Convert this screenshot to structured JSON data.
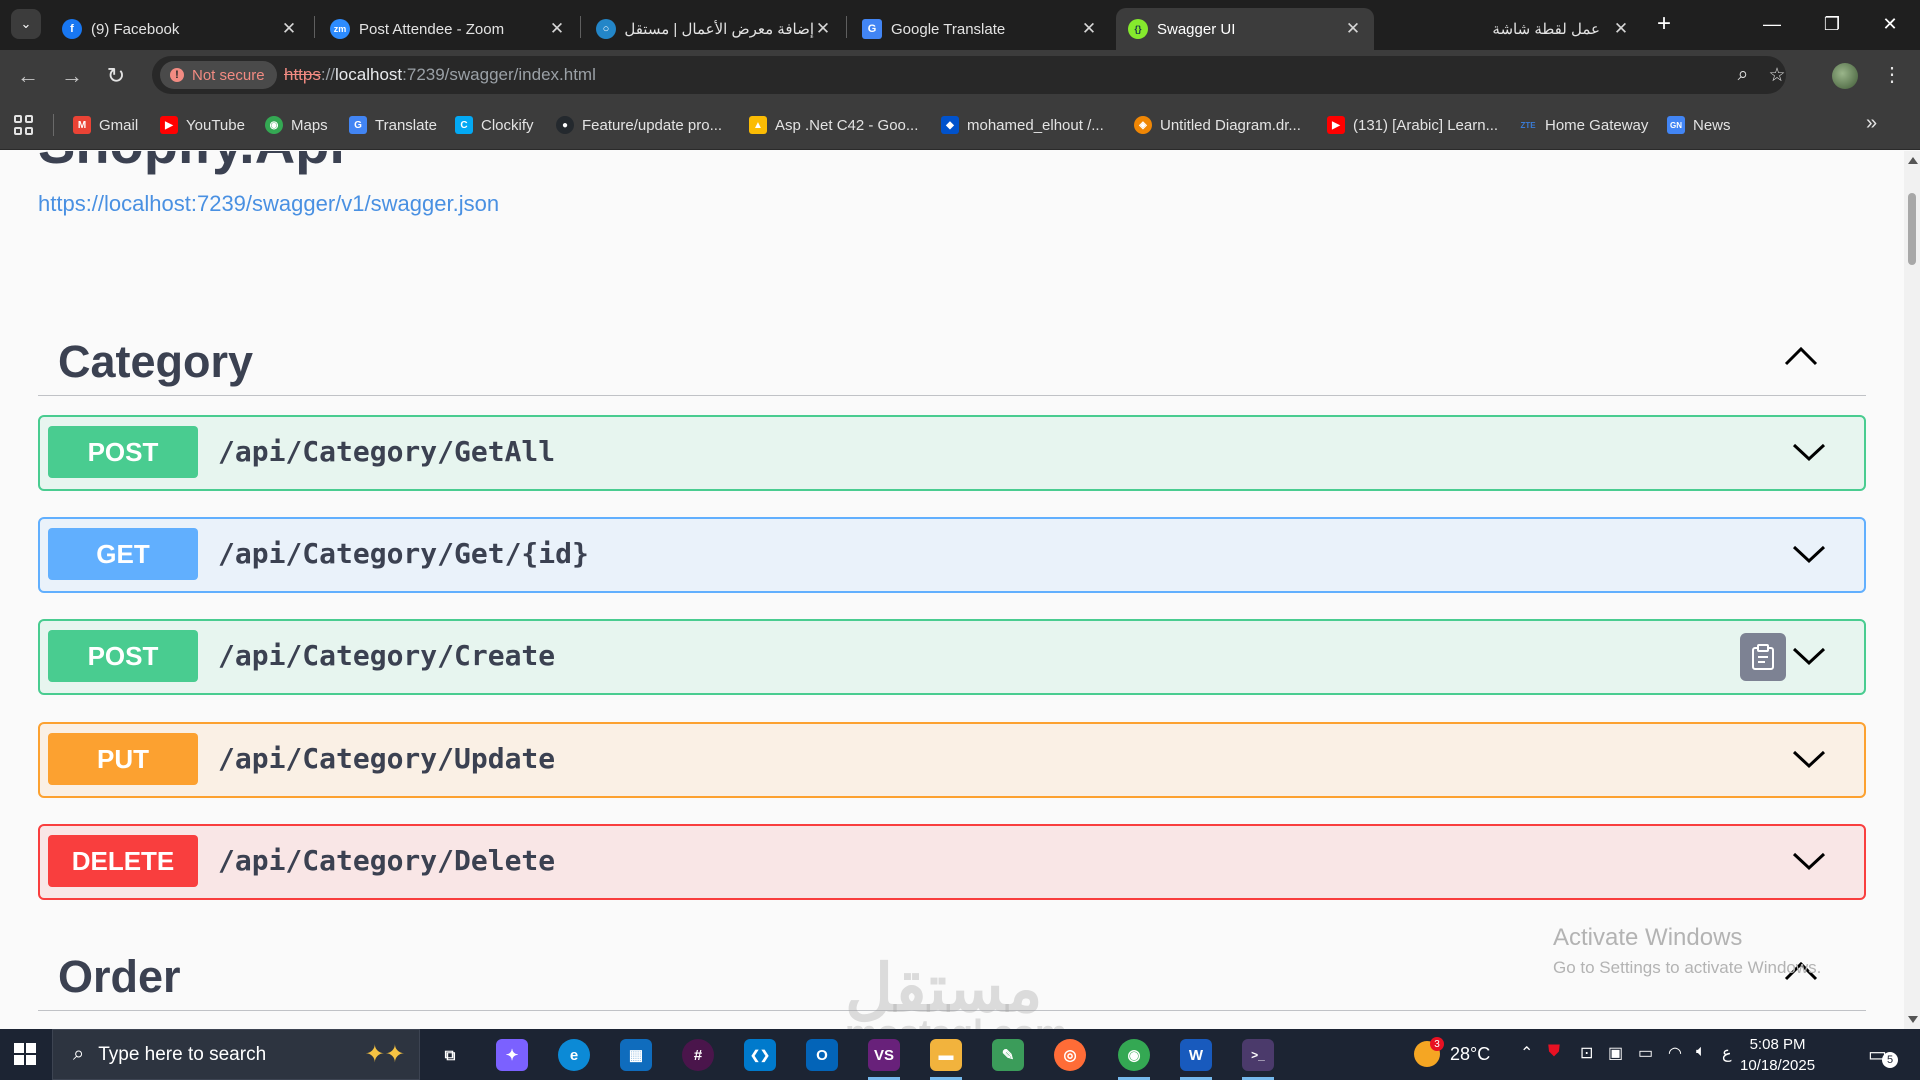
{
  "browser": {
    "tabs": [
      {
        "label": "(9) Facebook",
        "icon": "facebook-icon",
        "color": "#1877f2",
        "glyph": "f"
      },
      {
        "label": "Post Attendee - Zoom",
        "icon": "zoom-icon",
        "color": "#2d8cff",
        "glyph": "zm"
      },
      {
        "label": "إضافة معرض الأعمال | مستقل",
        "icon": "mostaql-icon",
        "color": "#2386c8",
        "glyph": "○"
      },
      {
        "label": "Google Translate",
        "icon": "google-translate-icon",
        "color": "#4285f4",
        "glyph": "G"
      },
      {
        "label": "Swagger UI",
        "icon": "swagger-icon",
        "color": "#85ea2d",
        "glyph": "{}"
      },
      {
        "label": "عمل لقطة شاشة",
        "icon": "",
        "color": "",
        "glyph": ""
      }
    ],
    "close_glyph": "✕",
    "new_tab_glyph": "+",
    "window_controls": {
      "minimize": "—",
      "restore": "❐",
      "close": "✕"
    },
    "security_chip": "Not secure",
    "url": {
      "scheme": "https",
      "separator": "://",
      "host": "localhost",
      "rest": ":7239/swagger/index.html"
    },
    "bookmarks": [
      {
        "label": "Gmail",
        "color": "#ea4335",
        "glyph": "M"
      },
      {
        "label": "YouTube",
        "color": "#ff0000",
        "glyph": "▶"
      },
      {
        "label": "Maps",
        "color": "#34a853",
        "glyph": "◉"
      },
      {
        "label": "Translate",
        "color": "#4285f4",
        "glyph": "G"
      },
      {
        "label": "Clockify",
        "color": "#03a9f4",
        "glyph": "C"
      },
      {
        "label": "Feature/update pro...",
        "color": "#24292e",
        "glyph": "●"
      },
      {
        "label": "Asp .Net C42 - Goo...",
        "color": "#fbbc04",
        "glyph": "▲"
      },
      {
        "label": "mohamed_elhout /...",
        "color": "#0052cc",
        "glyph": "◆"
      },
      {
        "label": "Untitled Diagram.dr...",
        "color": "#f08705",
        "glyph": "◈"
      },
      {
        "label": "(131) [Arabic] Learn...",
        "color": "#ff0000",
        "glyph": "▶"
      },
      {
        "label": "Home Gateway",
        "color": "#3a7bd5",
        "glyph": "ZTE"
      },
      {
        "label": "News",
        "color": "#4285f4",
        "glyph": "GN"
      }
    ],
    "bookmarks_more": "»"
  },
  "swagger": {
    "title": "Shopify.Api",
    "spec_link": "https://localhost:7239/swagger/v1/swagger.json",
    "sections": [
      {
        "name": "Category",
        "operations": [
          {
            "method": "POST",
            "path": "/api/Category/GetAll"
          },
          {
            "method": "GET",
            "path": "/api/Category/Get/{id}"
          },
          {
            "method": "POST",
            "path": "/api/Category/Create"
          },
          {
            "method": "PUT",
            "path": "/api/Category/Update"
          },
          {
            "method": "DELETE",
            "path": "/api/Category/Delete"
          }
        ]
      },
      {
        "name": "Order",
        "operations": []
      }
    ]
  },
  "watermarks": {
    "activate_title": "Activate Windows",
    "activate_sub": "Go to Settings to activate Windows.",
    "mostaql_ar": "مستقل",
    "mostaql_en": "mostaql.com"
  },
  "taskbar": {
    "search_placeholder": "Type here to search",
    "weather_temp": "28°C",
    "weather_badge": "3",
    "lang": "ع",
    "time": "5:08 PM",
    "date": "10/18/2025",
    "notifications_count": "5",
    "apps": [
      {
        "name": "task-view-icon",
        "glyph": "⧉",
        "color": "transparent"
      },
      {
        "name": "copilot-icon",
        "glyph": "✦",
        "color": "#7b61ff"
      },
      {
        "name": "edge-icon",
        "glyph": "e",
        "color": "#0c8ad6"
      },
      {
        "name": "store-icon",
        "glyph": "▦",
        "color": "#0f6cbd"
      },
      {
        "name": "slack-icon",
        "glyph": "#",
        "color": "#4a154b"
      },
      {
        "name": "vscode-icon",
        "glyph": "❮❯",
        "color": "#007acc"
      },
      {
        "name": "outlook-icon",
        "glyph": "O",
        "color": "#0364b8"
      },
      {
        "name": "visual-studio-icon",
        "glyph": "VS",
        "color": "#68217a"
      },
      {
        "name": "file-explorer-icon",
        "glyph": "▬",
        "color": "#f2b33d"
      },
      {
        "name": "photo-editor-icon",
        "glyph": "✎",
        "color": "#3b9c5a"
      },
      {
        "name": "postman-icon",
        "glyph": "◎",
        "color": "#ff6c37"
      },
      {
        "name": "chrome-icon",
        "glyph": "◉",
        "color": "#34a853"
      },
      {
        "name": "word-icon",
        "glyph": "W",
        "color": "#185abd"
      },
      {
        "name": "terminal-icon",
        "glyph": ">_",
        "color": "#4b3a6b"
      }
    ]
  }
}
